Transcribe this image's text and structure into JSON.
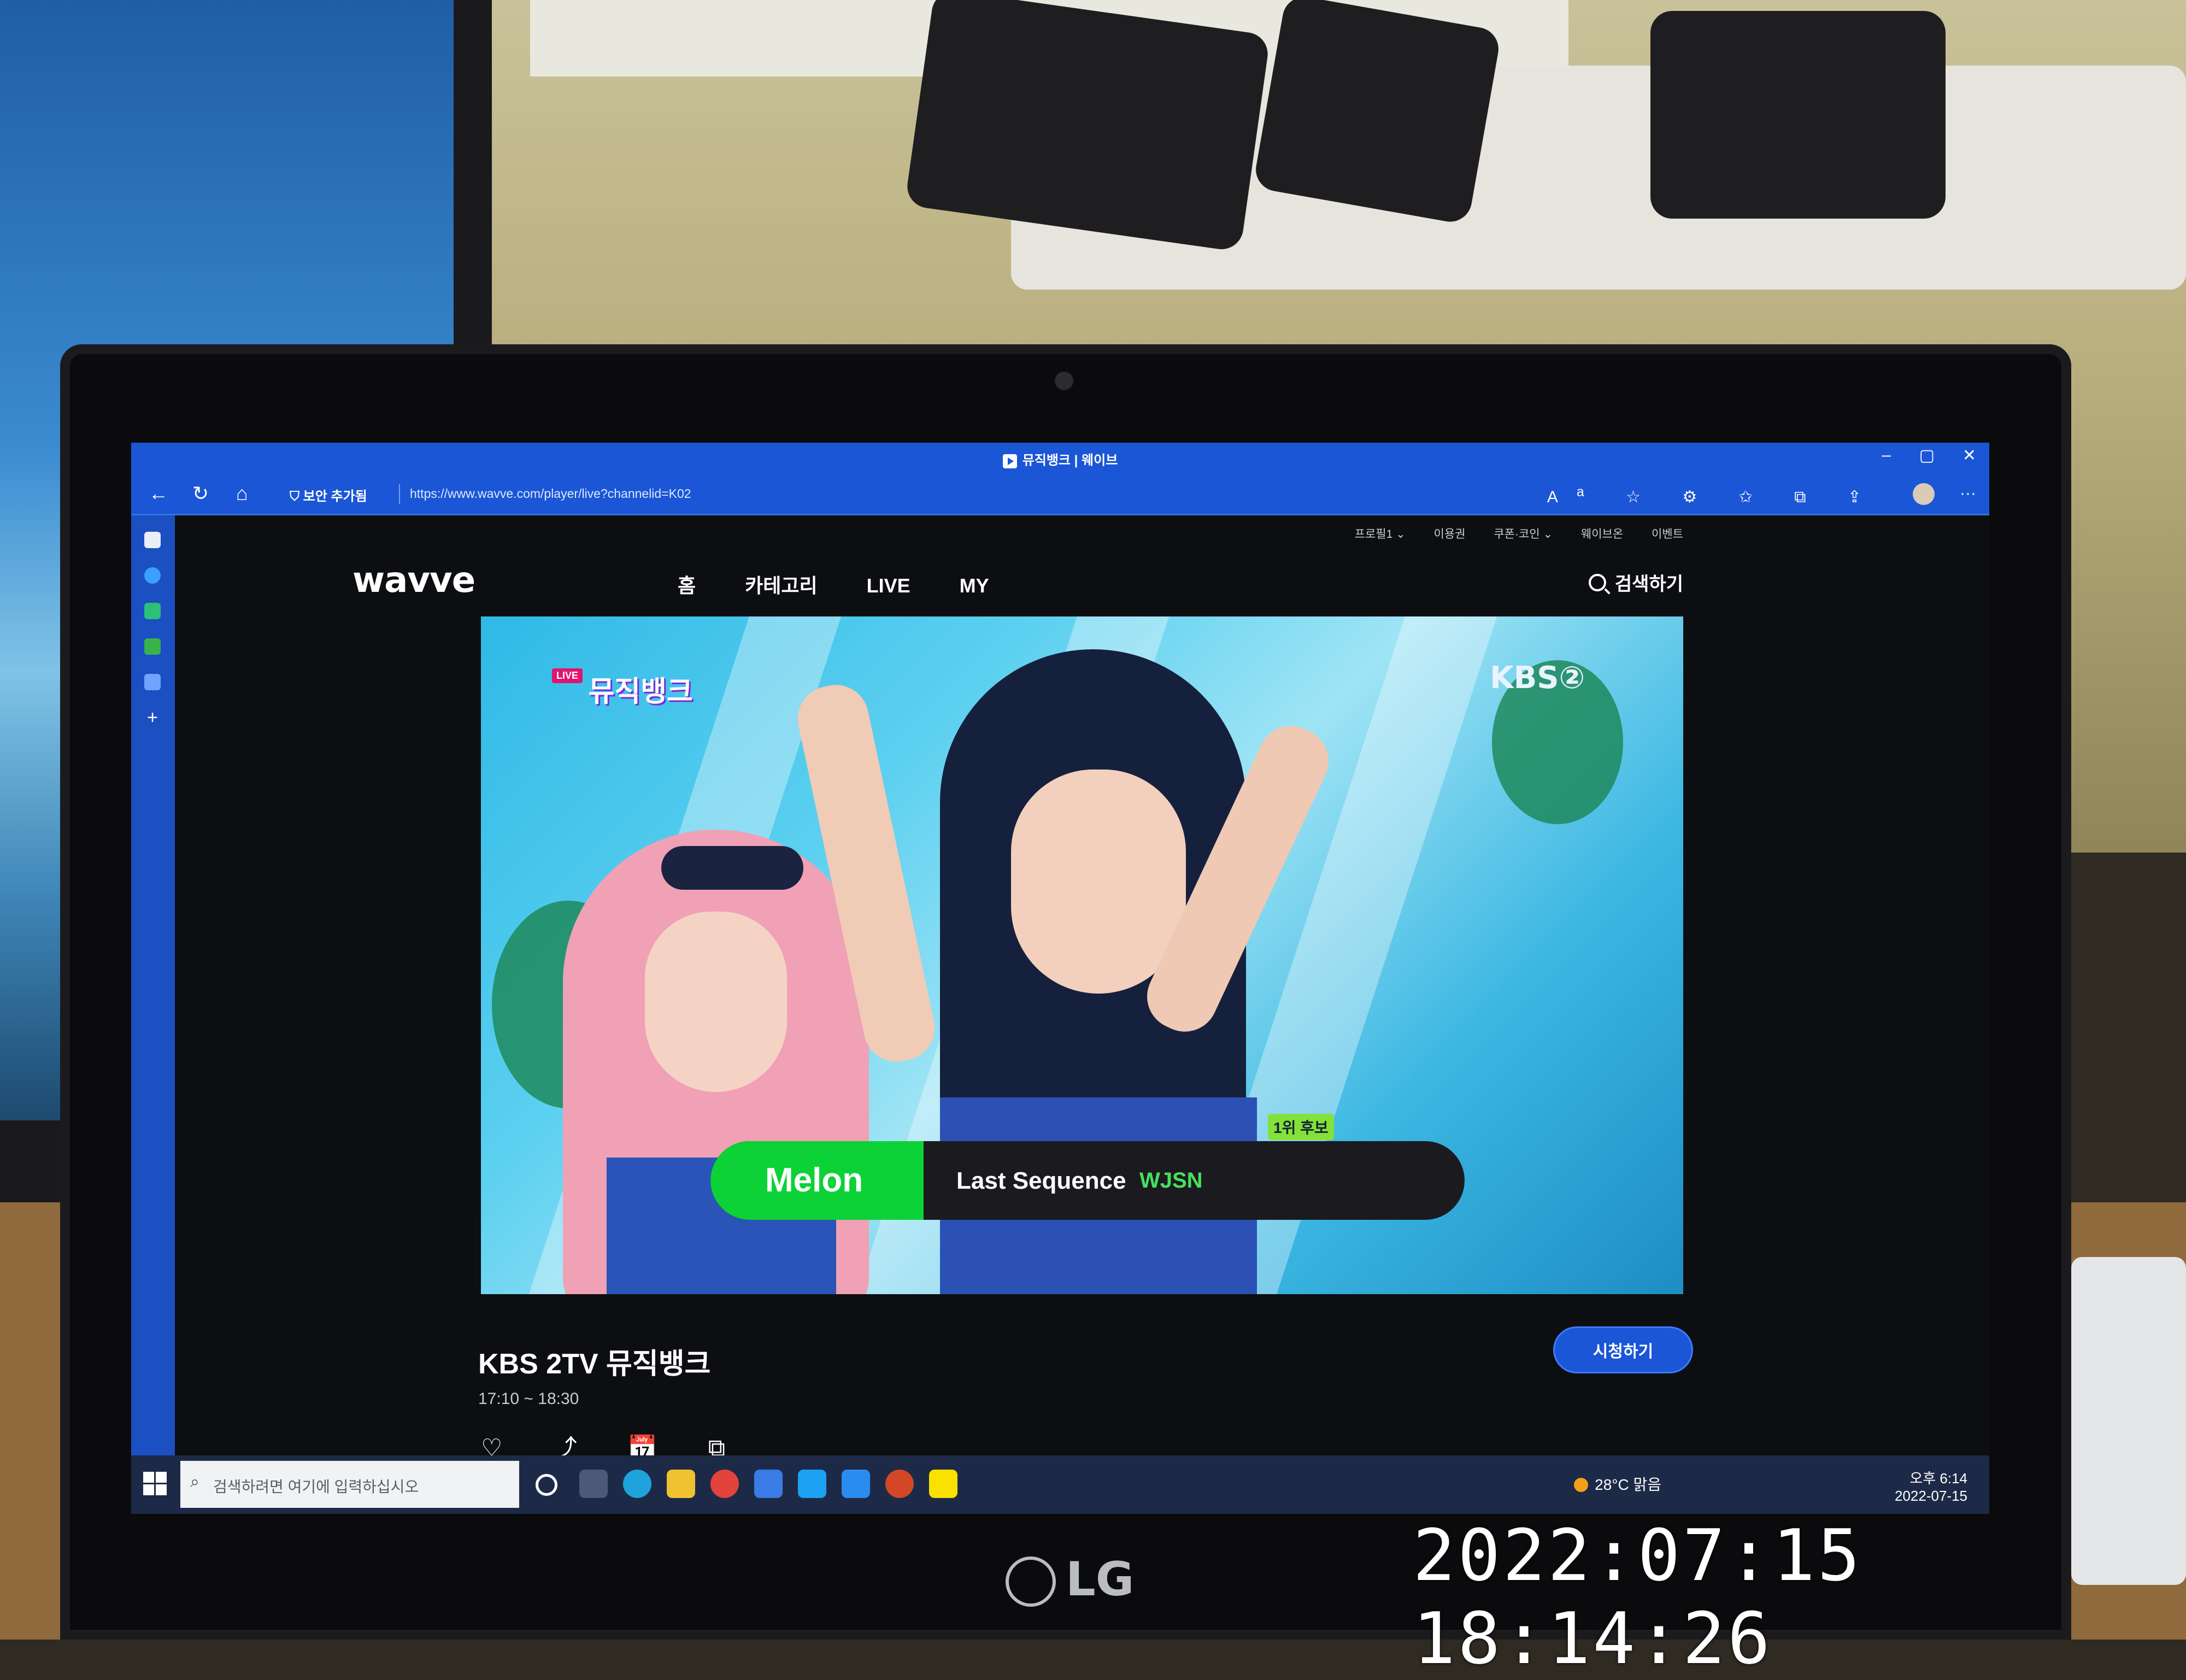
{
  "photo_timestamp": "2022:07:15 18:14:26",
  "laptop_brand": "LG",
  "browser": {
    "tab_title": "뮤직뱅크 | 웨이브",
    "security_label": "보안 추가됨",
    "url": "https://www.wavve.com/player/live?channelid=K02",
    "controls": {
      "minimize": "–",
      "maximize": "▢",
      "close": "✕"
    },
    "nav": {
      "back": "←",
      "refresh": "↻",
      "home": "⌂"
    }
  },
  "site": {
    "logo": "wavve",
    "top_menu": [
      "프로필1 ⌄",
      "이용권",
      "쿠폰·코인 ⌄",
      "웨이브온",
      "이벤트"
    ],
    "nav_items": [
      "홈",
      "카테고리",
      "LIVE",
      "MY"
    ],
    "search_label": "검색하기"
  },
  "player": {
    "channel_badge": "KBS②",
    "live_badge": "LIVE",
    "show_logo": "뮤직뱅크",
    "candidate_badge": "1위 후보",
    "melon_label": "Melon",
    "song_title": "Last Sequence",
    "artist": "WJSN"
  },
  "program": {
    "title": "KBS 2TV 뮤직뱅크",
    "time": "17:10 ~ 18:30",
    "watch_button": "시청하기",
    "actions": [
      "♡",
      "⤴",
      "📅",
      "⧉"
    ]
  },
  "taskbar": {
    "search_placeholder": "검색하려면 여기에 입력하십시오",
    "weather": "28°C 맑음",
    "time": "오후 6:14",
    "date": "2022-07-15"
  },
  "colors": {
    "browser_blue": "#1a56d6",
    "melon_green": "#0dd237",
    "artist_green": "#47e05c",
    "page_bg": "#0d0e11"
  }
}
